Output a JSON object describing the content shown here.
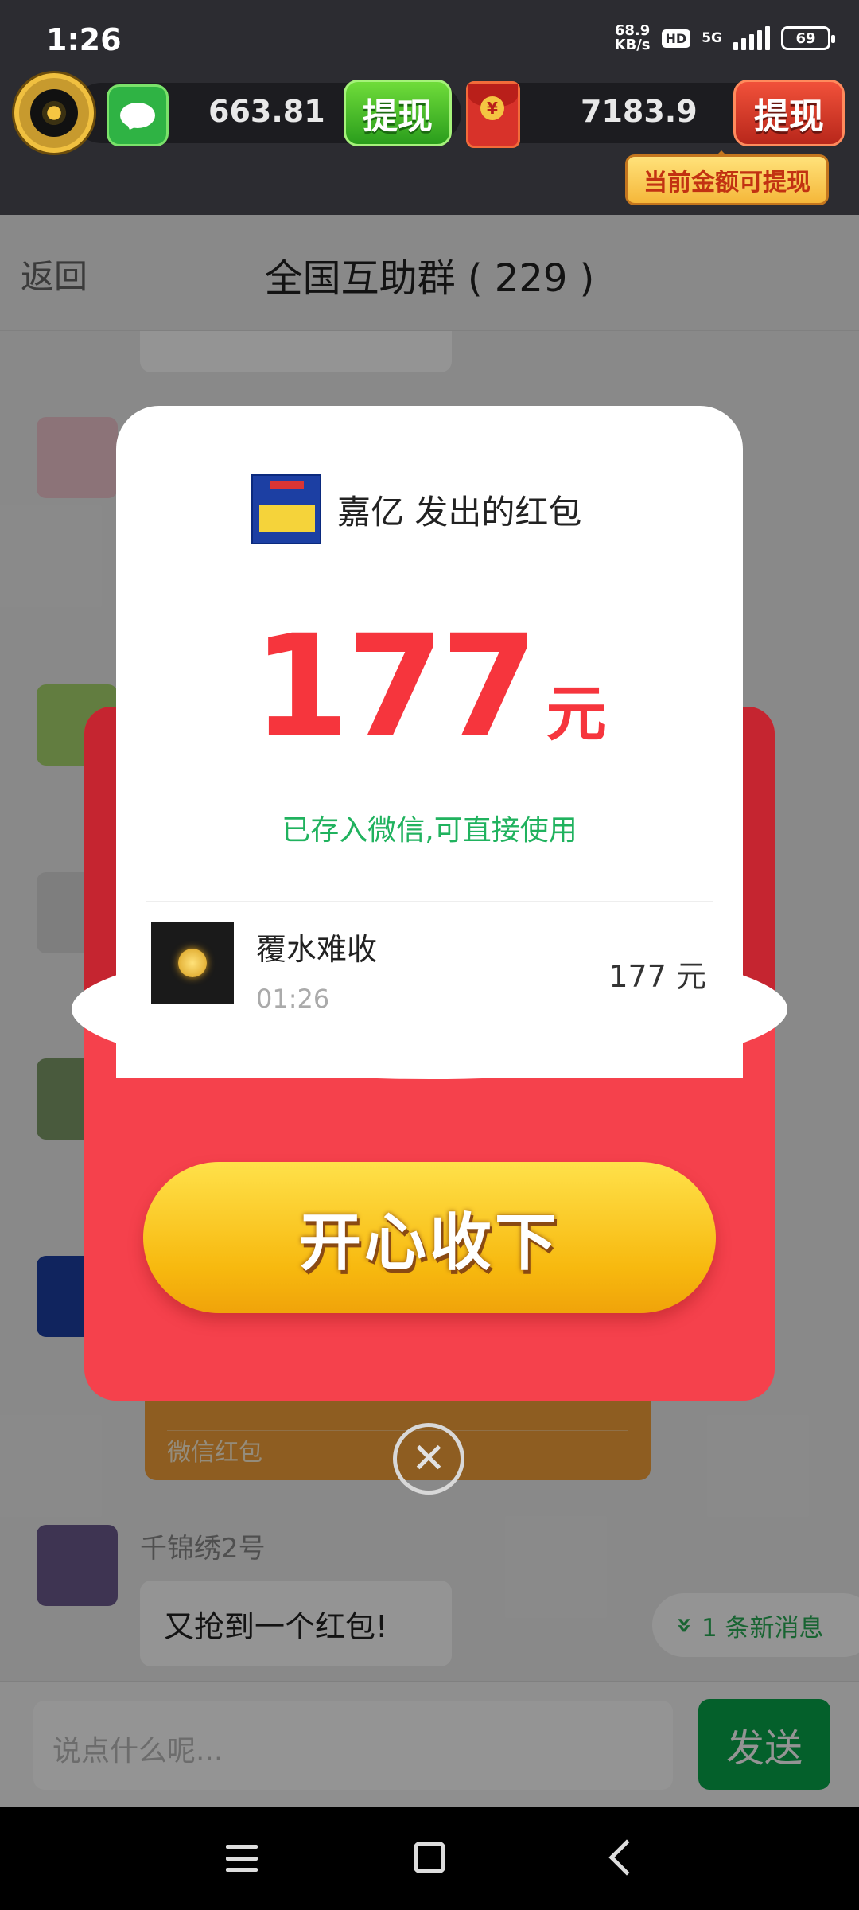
{
  "status_bar": {
    "time": "1:26",
    "net_speed_top": "68.9",
    "net_speed_bottom": "KB/s",
    "hd": "HD",
    "network": "5G",
    "battery": "69"
  },
  "top_banner": {
    "wechat_balance": "663.81",
    "withdraw_green_label": "提现",
    "redpacket_balance": "7183.9",
    "withdraw_red_label": "提现",
    "tip": "当前金额可提现"
  },
  "navbar": {
    "back_label": "返回",
    "title": "全国互助群 ( 229 )"
  },
  "chat": {
    "redpacket_card_label": "微信红包",
    "last_sender": "千锦绣2号",
    "last_message": "又抢到一个红包!",
    "new_messages": "1 条新消息"
  },
  "input_bar": {
    "placeholder": "说点什么呢...",
    "send_label": "发送"
  },
  "modal": {
    "sender_title": "嘉亿 发出的红包",
    "amount": "177",
    "amount_unit": "元",
    "saved_note": "已存入微信,可直接使用",
    "record": {
      "name": "覆水难收",
      "time": "01:26",
      "amount": "177 元"
    },
    "accept_label": "开心收下",
    "close_icon": "close-icon"
  },
  "colors": {
    "red_envelope": "#f5414c",
    "amount_red": "#f6353d",
    "saved_green": "#20b25e",
    "send_green": "#07a54b",
    "gold_button": "#f7b90f"
  }
}
